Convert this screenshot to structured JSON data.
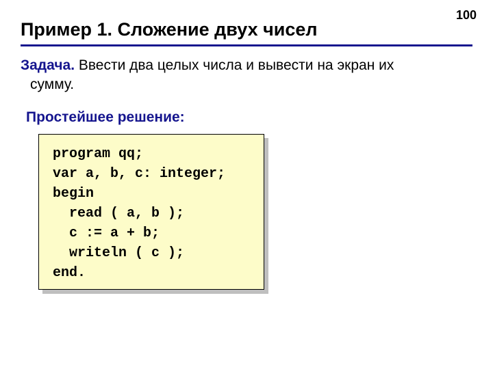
{
  "page_number": "100",
  "title": "Пример 1. Сложение двух чисел",
  "task": {
    "label": "Задача.",
    "text_line1": " Ввести два целых числа и вывести на экран их",
    "text_line2": "сумму."
  },
  "subheading": "Простейшее решение:",
  "code": "program qq;\nvar a, b, c: integer;\nbegin\n  read ( a, b );\n  c := a + b;\n  writeln ( c );\nend."
}
